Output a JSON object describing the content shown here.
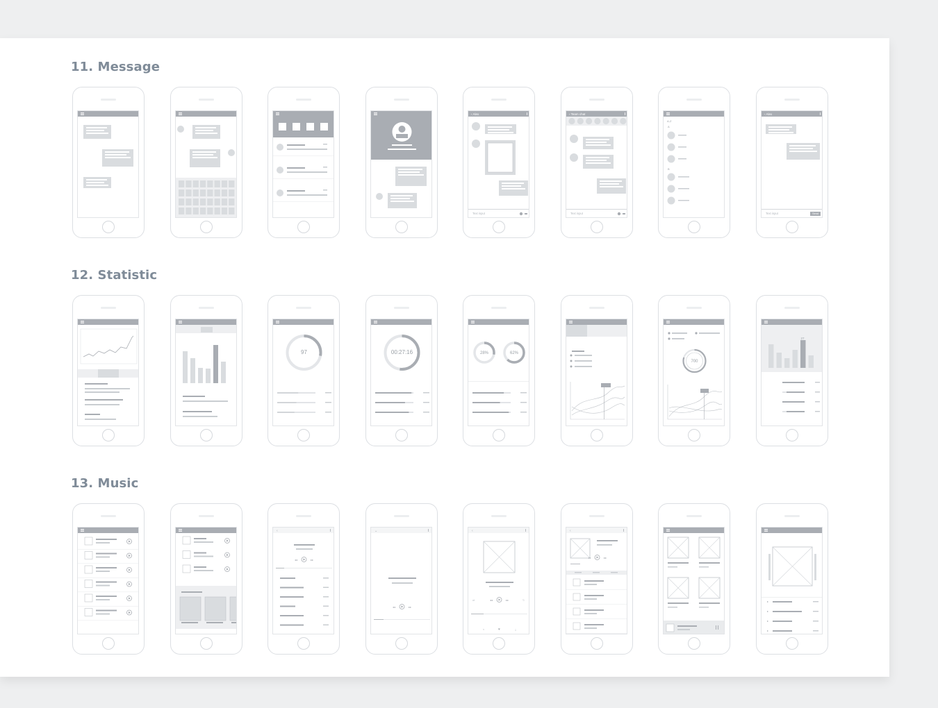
{
  "sections": [
    {
      "title": "11. Message",
      "kind": "message"
    },
    {
      "title": "12. Statistic",
      "kind": "statistic"
    },
    {
      "title": "13. Music",
      "kind": "music"
    }
  ],
  "screens": {
    "message": [
      {
        "variant": "chat-bubbles"
      },
      {
        "variant": "chat-keyboard"
      },
      {
        "variant": "contacts-list"
      },
      {
        "variant": "profile-chat"
      },
      {
        "variant": "chat-image",
        "header": "Alex",
        "input": "Text input"
      },
      {
        "variant": "team-chat",
        "header": "Team chat",
        "input": "Text input"
      },
      {
        "variant": "contacts-az",
        "index_top": "A-Z",
        "index_a": "A",
        "index_b": "B"
      },
      {
        "variant": "chat-send",
        "header": "Alex",
        "input": "Text input",
        "button": "Send"
      }
    ],
    "statistic": [
      {
        "variant": "line-chart"
      },
      {
        "variant": "bar-chart"
      },
      {
        "variant": "donut",
        "value": "97"
      },
      {
        "variant": "timer-donut",
        "value": "00:27:16"
      },
      {
        "variant": "two-donuts",
        "value_a": "28%",
        "value_b": "62%"
      },
      {
        "variant": "multi-line"
      },
      {
        "variant": "ring-lines",
        "value": "700"
      },
      {
        "variant": "bars-list",
        "value": "27"
      }
    ],
    "music": [
      {
        "variant": "track-list"
      },
      {
        "variant": "track-list-albums"
      },
      {
        "variant": "player-list"
      },
      {
        "variant": "player-simple"
      },
      {
        "variant": "player-cover"
      },
      {
        "variant": "album-tracks"
      },
      {
        "variant": "album-grid"
      },
      {
        "variant": "cover-carousel"
      }
    ]
  },
  "colors": {
    "bar": "#a9adb3",
    "block": "#d9dcdf",
    "line": "#c9cdd1",
    "stroke": "#bfc3c8",
    "title": "#7f8b98"
  }
}
